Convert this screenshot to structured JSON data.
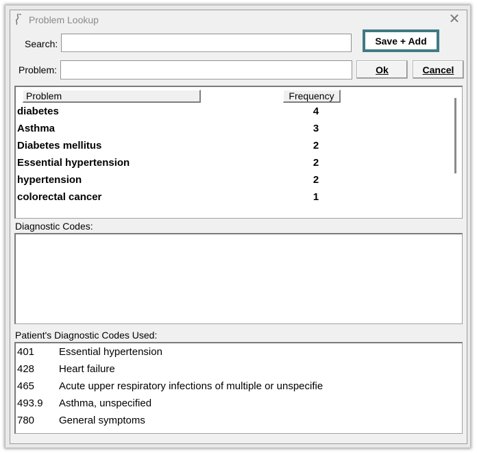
{
  "window": {
    "title": "Problem Lookup"
  },
  "search": {
    "label": "Search:",
    "value": ""
  },
  "problem": {
    "label": "Problem:",
    "value": ""
  },
  "buttons": {
    "save_add": "Save + Add",
    "ok": "Ok",
    "cancel": "Cancel"
  },
  "problem_table": {
    "headers": {
      "problem": "Problem",
      "frequency": "Frequency"
    },
    "rows": [
      {
        "problem": "diabetes",
        "frequency": "4"
      },
      {
        "problem": "Asthma",
        "frequency": "3"
      },
      {
        "problem": "Diabetes mellitus",
        "frequency": "2"
      },
      {
        "problem": "Essential hypertension",
        "frequency": "2"
      },
      {
        "problem": "hypertension",
        "frequency": "2"
      },
      {
        "problem": "colorectal cancer",
        "frequency": "1"
      }
    ]
  },
  "diagnostic_codes": {
    "label": "Diagnostic Codes:"
  },
  "used_codes": {
    "label": "Patient's Diagnostic Codes Used:",
    "rows": [
      {
        "code": "401",
        "description": "Essential hypertension"
      },
      {
        "code": "428",
        "description": "Heart failure"
      },
      {
        "code": "465",
        "description": "Acute upper respiratory infections of multiple or unspecifie"
      },
      {
        "code": "493.9",
        "description": "Asthma, unspecified"
      },
      {
        "code": "780",
        "description": "General symptoms"
      }
    ]
  },
  "colors": {
    "accent": "#3f7a85"
  }
}
